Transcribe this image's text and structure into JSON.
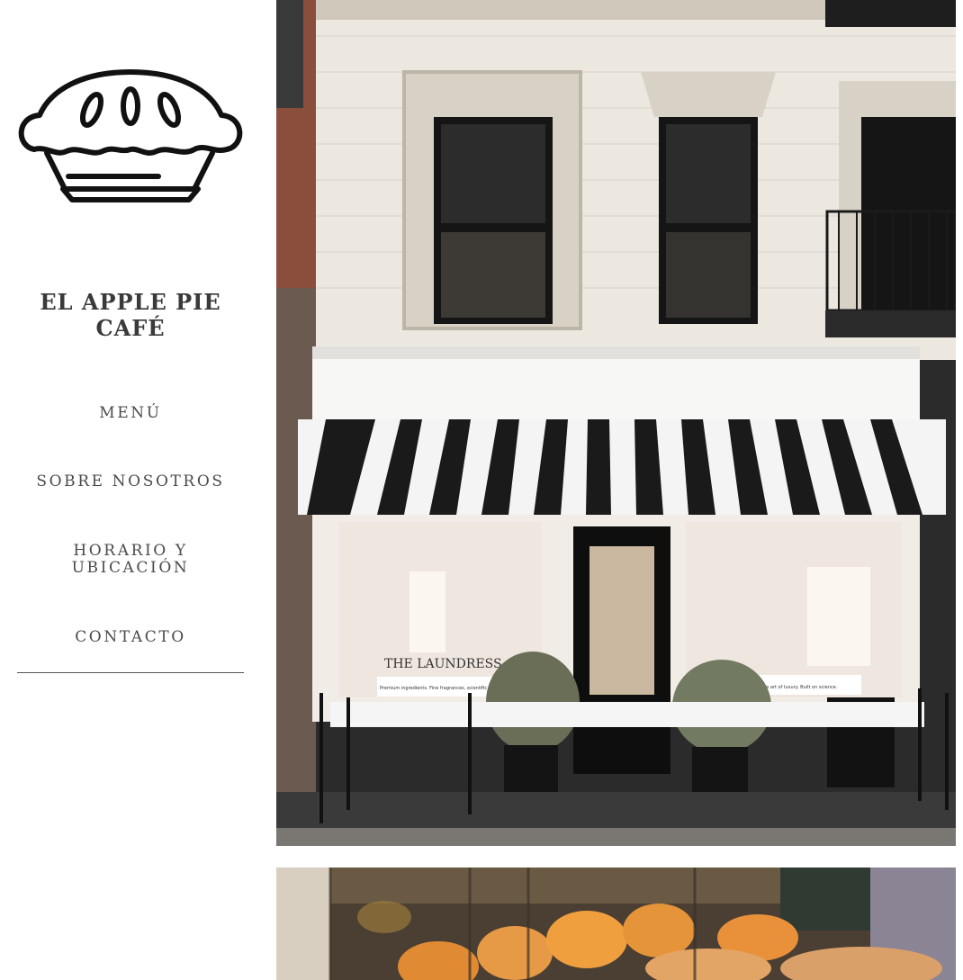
{
  "site": {
    "title_line1": "EL APPLE PIE",
    "title_line2": "CAFÉ",
    "logo_icon": "pie-icon"
  },
  "nav": {
    "items": [
      {
        "label": "MENÚ"
      },
      {
        "label": "SOBRE NOSOTROS"
      },
      {
        "label": "HORARIO Y"
      },
      {
        "label": "UBICACIÓN"
      },
      {
        "label": "CONTACTO"
      }
    ]
  },
  "gallery": {
    "storefront_window_left_sign": "THE LAUNDRESS",
    "storefront_window_left_caption": "Premium ingredients. Fine fragrances, scientific formulas.",
    "storefront_window_right_caption": "The art of luxury. Built on science."
  },
  "colors": {
    "text": "#3a3a3a",
    "nav_text": "#4a4a4a",
    "awning_dark": "#1a1a1a",
    "awning_light": "#f4f4f4",
    "brick_wall": "#ece8e0"
  }
}
